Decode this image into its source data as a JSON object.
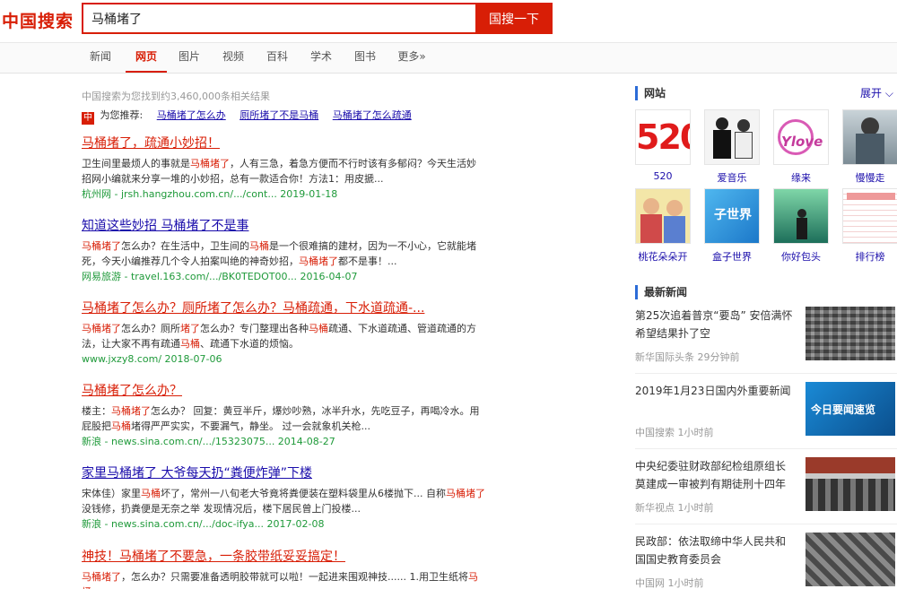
{
  "header": {
    "logo": "中国搜索",
    "query": "马桶堵了",
    "search_button": "国搜一下"
  },
  "nav": {
    "tabs": [
      "新闻",
      "网页",
      "图片",
      "视频",
      "百科",
      "学术",
      "图书",
      "更多»"
    ],
    "active": "网页"
  },
  "results_count": "中国搜索为您找到约3,460,000条相关结果",
  "recommend": {
    "badge": "中",
    "label": "为您推荐:",
    "links": [
      "马桶堵了怎么办",
      "厕所堵了不是马桶",
      "马桶堵了怎么疏通"
    ]
  },
  "results": [
    {
      "title": "马桶堵了，疏通小妙招！",
      "snippet": [
        "卫生间里最烦人的事就是",
        "马桶堵了",
        "，人有三急，着急方便而不行时该有多郁闷？今天生活妙招网小编就来分享一堆的小妙招，总有一款适合你！方法1：用皮搋..."
      ],
      "source": "杭州网 - jrsh.hangzhou.com.cn/.../cont... 2019-01-18"
    },
    {
      "title": "知道这些妙招 马桶堵了不是事",
      "snippet": [
        "马桶堵了",
        "怎么办？在生活中，卫生间的",
        "马桶",
        "是一个很难搞的建材，因为一不小心，它就能堵死，今天小编推荐几个令人拍案叫绝的神奇妙招，",
        "马桶堵了",
        "都不是事！..."
      ],
      "source": "网易旅游 - travel.163.com/.../BK0TEDOT00... 2016-04-07"
    },
    {
      "title": "马桶堵了怎么办？厕所堵了怎么办？马桶疏通，下水道疏通-...",
      "snippet": [
        "马桶堵了",
        "怎么办？厕所",
        "堵了",
        "怎么办？专门整理出各种",
        "马桶",
        "疏通、下水道疏通、管道疏通的方法，让大家不再有疏通",
        "马桶",
        "、疏通下水道的烦恼。"
      ],
      "source": "www.jxzy8.com/ 2018-07-06"
    },
    {
      "title": "马桶堵了怎么办？",
      "snippet": [
        "楼主：",
        "马桶堵了",
        "怎么办？ 回复：黄豆半斤，爆炒吵熟，冰半升水，先吃豆子，再喝冷水。用屁股把",
        "马桶",
        "堵得严严实实，不要漏气，静坐。 过一会就象机关枪..."
      ],
      "source": "新浪 - news.sina.com.cn/.../15323075... 2014-08-27"
    },
    {
      "title": "家里马桶堵了 大爷每天扔“粪便炸弹”下楼",
      "snippet": [
        "宋体佳）家里",
        "马桶",
        "坏了，常州一八旬老大爷竟将粪便装在塑料袋里从6楼抛下... 自称",
        "马桶堵了",
        "没钱修，扔粪便是无奈之举 发现情况后，楼下居民曾上门投楼..."
      ],
      "source": "新浪 - news.sina.com.cn/.../doc-ifya... 2017-02-08"
    },
    {
      "title": "神技！马桶堵了不要急，一条胶带纸妥妥搞定！",
      "snippet": [
        "马桶堵了",
        "，怎么办？只需要准备透明胶带就可以啦！一起进来围观神技...... 1.用卫生纸将",
        "马",
        "桶"
      ],
      "source": ""
    }
  ],
  "sidebar": {
    "sites_title": "网站",
    "expand": "展开",
    "sites": [
      {
        "label": "520",
        "thumb_text": "520"
      },
      {
        "label": "爱音乐",
        "thumb_text": ""
      },
      {
        "label": "缘来",
        "thumb_text": "Ylove"
      },
      {
        "label": "慢慢走",
        "thumb_text": ""
      },
      {
        "label": "桃花朵朵开",
        "thumb_text": ""
      },
      {
        "label": "盒子世界",
        "thumb_text": "子世界"
      },
      {
        "label": "你好包头",
        "thumb_text": ""
      },
      {
        "label": "排行榜",
        "thumb_text": ""
      }
    ],
    "news_title": "最新新闻",
    "news": [
      {
        "title": "第25次追着普京“要岛” 安倍满怀希望结果扑了空",
        "meta": "新华国际头条 29分钟前"
      },
      {
        "title": "2019年1月23日国内外重要新闻",
        "meta": "中国搜索 1小时前",
        "thumb_text": "今日要闻速览"
      },
      {
        "title": "中央纪委驻财政部纪检组原组长莫建成一审被判有期徒刑十四年",
        "meta": "新华视点 1小时前"
      },
      {
        "title": "民政部：依法取缔中华人民共和国国史教育委员会",
        "meta": "中国网 1小时前"
      }
    ]
  },
  "colors": {
    "brand": "#d81e06",
    "link": "#1a0dab",
    "source": "#1f9a3a",
    "sidebar_accent": "#2c6cd7"
  }
}
